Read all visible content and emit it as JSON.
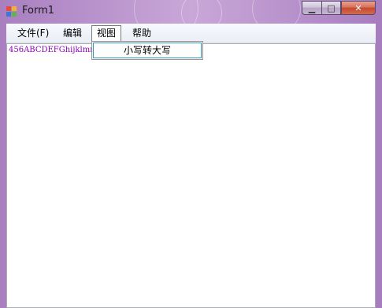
{
  "window": {
    "title": "Form1",
    "minimize_glyph": "▁",
    "maximize_glyph": "□",
    "close_glyph": "✕"
  },
  "menubar": {
    "items": [
      {
        "label": "文件(F)"
      },
      {
        "label": "编辑"
      },
      {
        "label": "视图"
      },
      {
        "label": "帮助"
      }
    ],
    "open_menu": "视图",
    "dropdown_items": [
      {
        "label": "小写转大写"
      }
    ]
  },
  "editor": {
    "text": "456ABCDEFGhijklmn1"
  },
  "colors": {
    "frame": "#b893cc",
    "text": "#8a00b3",
    "menu_highlight_border": "#3b98b4",
    "close_button": "#c24a2f"
  }
}
